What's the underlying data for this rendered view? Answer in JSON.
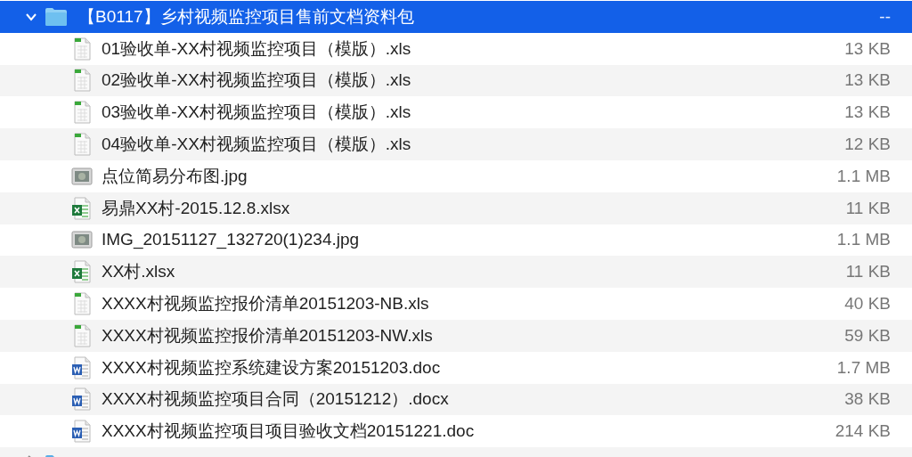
{
  "folder": {
    "name": "【B0117】乡村视频监控项目售前文档资料包",
    "size": "--",
    "expanded": true,
    "selected": true
  },
  "files": [
    {
      "kind": "sheet",
      "name": "01验收单-XX村视频监控项目（模版）.xls",
      "size": "13 KB"
    },
    {
      "kind": "sheet",
      "name": "02验收单-XX村视频监控项目（模版）.xls",
      "size": "13 KB"
    },
    {
      "kind": "sheet",
      "name": "03验收单-XX村视频监控项目（模版）.xls",
      "size": "13 KB"
    },
    {
      "kind": "sheet",
      "name": "04验收单-XX村视频监控项目（模版）.xls",
      "size": "12 KB"
    },
    {
      "kind": "image",
      "name": "点位简易分布图.jpg",
      "size": "1.1 MB"
    },
    {
      "kind": "excel",
      "name": "易鼎XX村-2015.12.8.xlsx",
      "size": "11 KB"
    },
    {
      "kind": "image",
      "name": "IMG_20151127_132720(1)234.jpg",
      "size": "1.1 MB"
    },
    {
      "kind": "excel",
      "name": "XX村.xlsx",
      "size": "11 KB"
    },
    {
      "kind": "sheet",
      "name": "XXXX村视频监控报价清单20151203-NB.xls",
      "size": "40 KB"
    },
    {
      "kind": "sheet",
      "name": "XXXX村视频监控报价清单20151203-NW.xls",
      "size": "59 KB"
    },
    {
      "kind": "word",
      "name": "XXXX村视频监控系统建设方案20151203.doc",
      "size": "1.7 MB"
    },
    {
      "kind": "word",
      "name": "XXXX村视频监控项目合同（20151212）.docx",
      "size": "38 KB"
    },
    {
      "kind": "word",
      "name": "XXXX村视频监控项目项目验收文档20151221.doc",
      "size": "214 KB"
    }
  ],
  "next_folder": {
    "expanded": false
  }
}
